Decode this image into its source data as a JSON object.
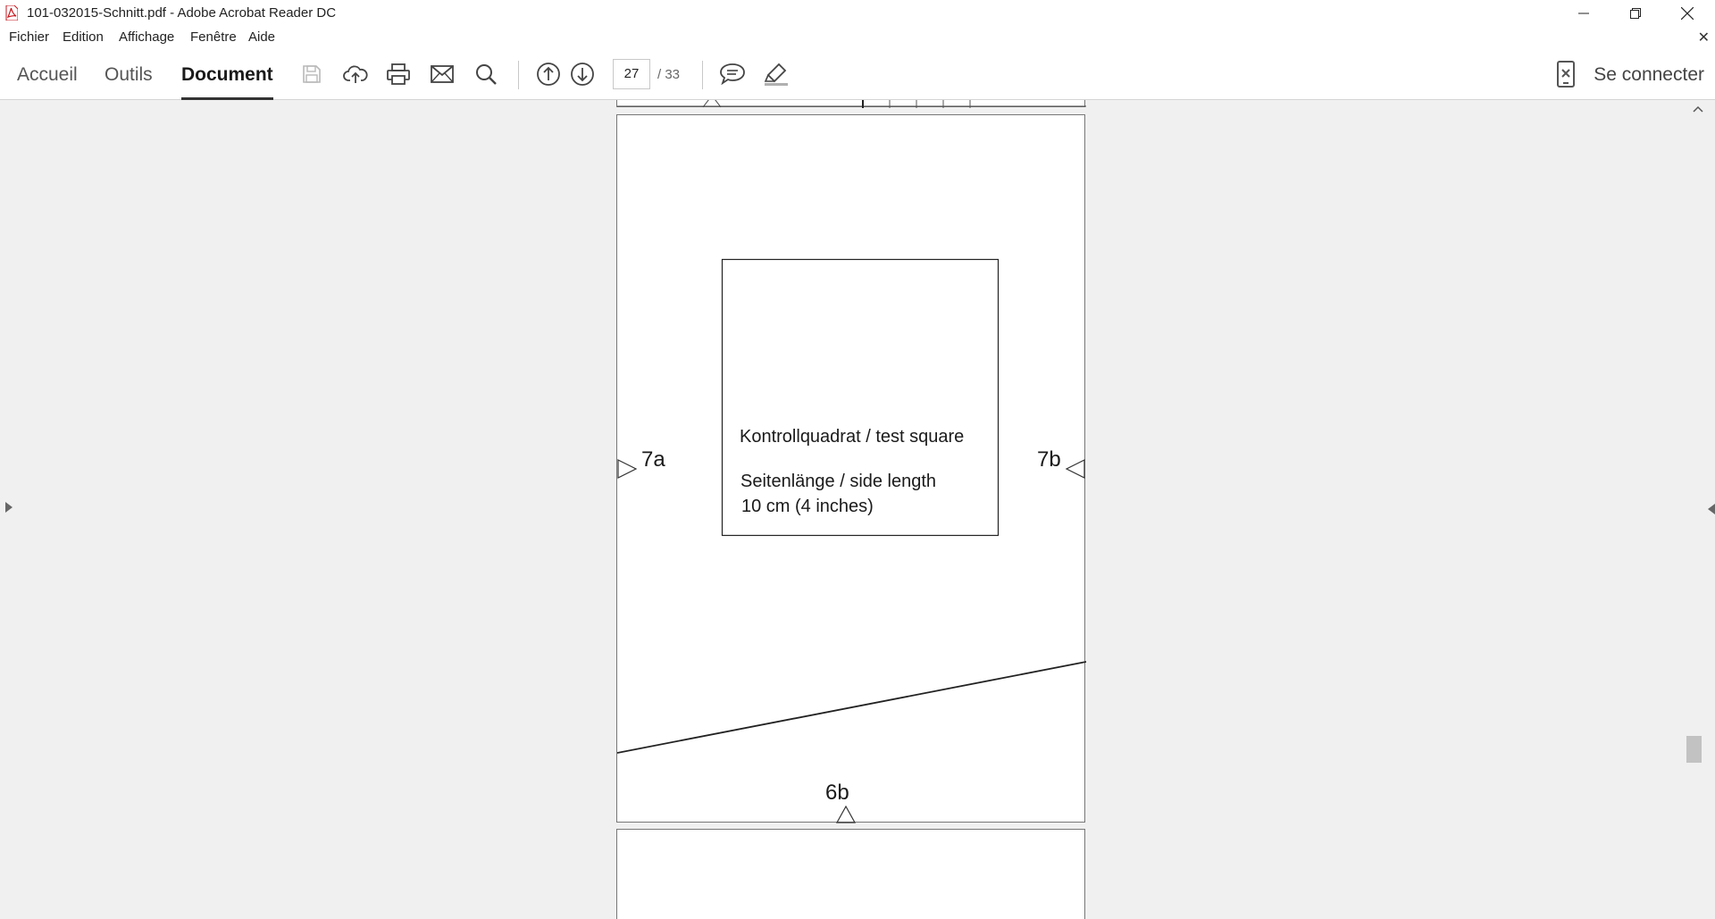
{
  "window": {
    "title": "101-032015-Schnitt.pdf - Adobe Acrobat Reader DC",
    "controls": [
      "minimize",
      "restore",
      "close"
    ]
  },
  "menu": {
    "items": [
      "Fichier",
      "Edition",
      "Affichage",
      "Fenêtre",
      "Aide"
    ]
  },
  "toolbar": {
    "tabs": [
      "Accueil",
      "Outils",
      "Document"
    ],
    "active_tab": "Document",
    "tools": [
      "save-icon",
      "cloud-upload-icon",
      "print-icon",
      "email-icon",
      "search-icon",
      "page-up-icon",
      "page-down-icon",
      "comment-icon",
      "highlight-icon"
    ],
    "page_current": "27",
    "page_total": "/ 33",
    "signin_label": "Se connecter"
  },
  "document": {
    "test_square_title": "Kontrollquadrat / test square",
    "side_length_label": "Seitenlänge / side length",
    "side_length_value": "10 cm (4 inches)",
    "marker_left": "7a",
    "marker_right": "7b",
    "marker_bottom": "6b"
  },
  "colors": {
    "toolbar_bg": "#ffffff",
    "document_bg": "#f0f0f0",
    "page_bg": "#ffffff",
    "app_icon_red": "#c4161c"
  }
}
